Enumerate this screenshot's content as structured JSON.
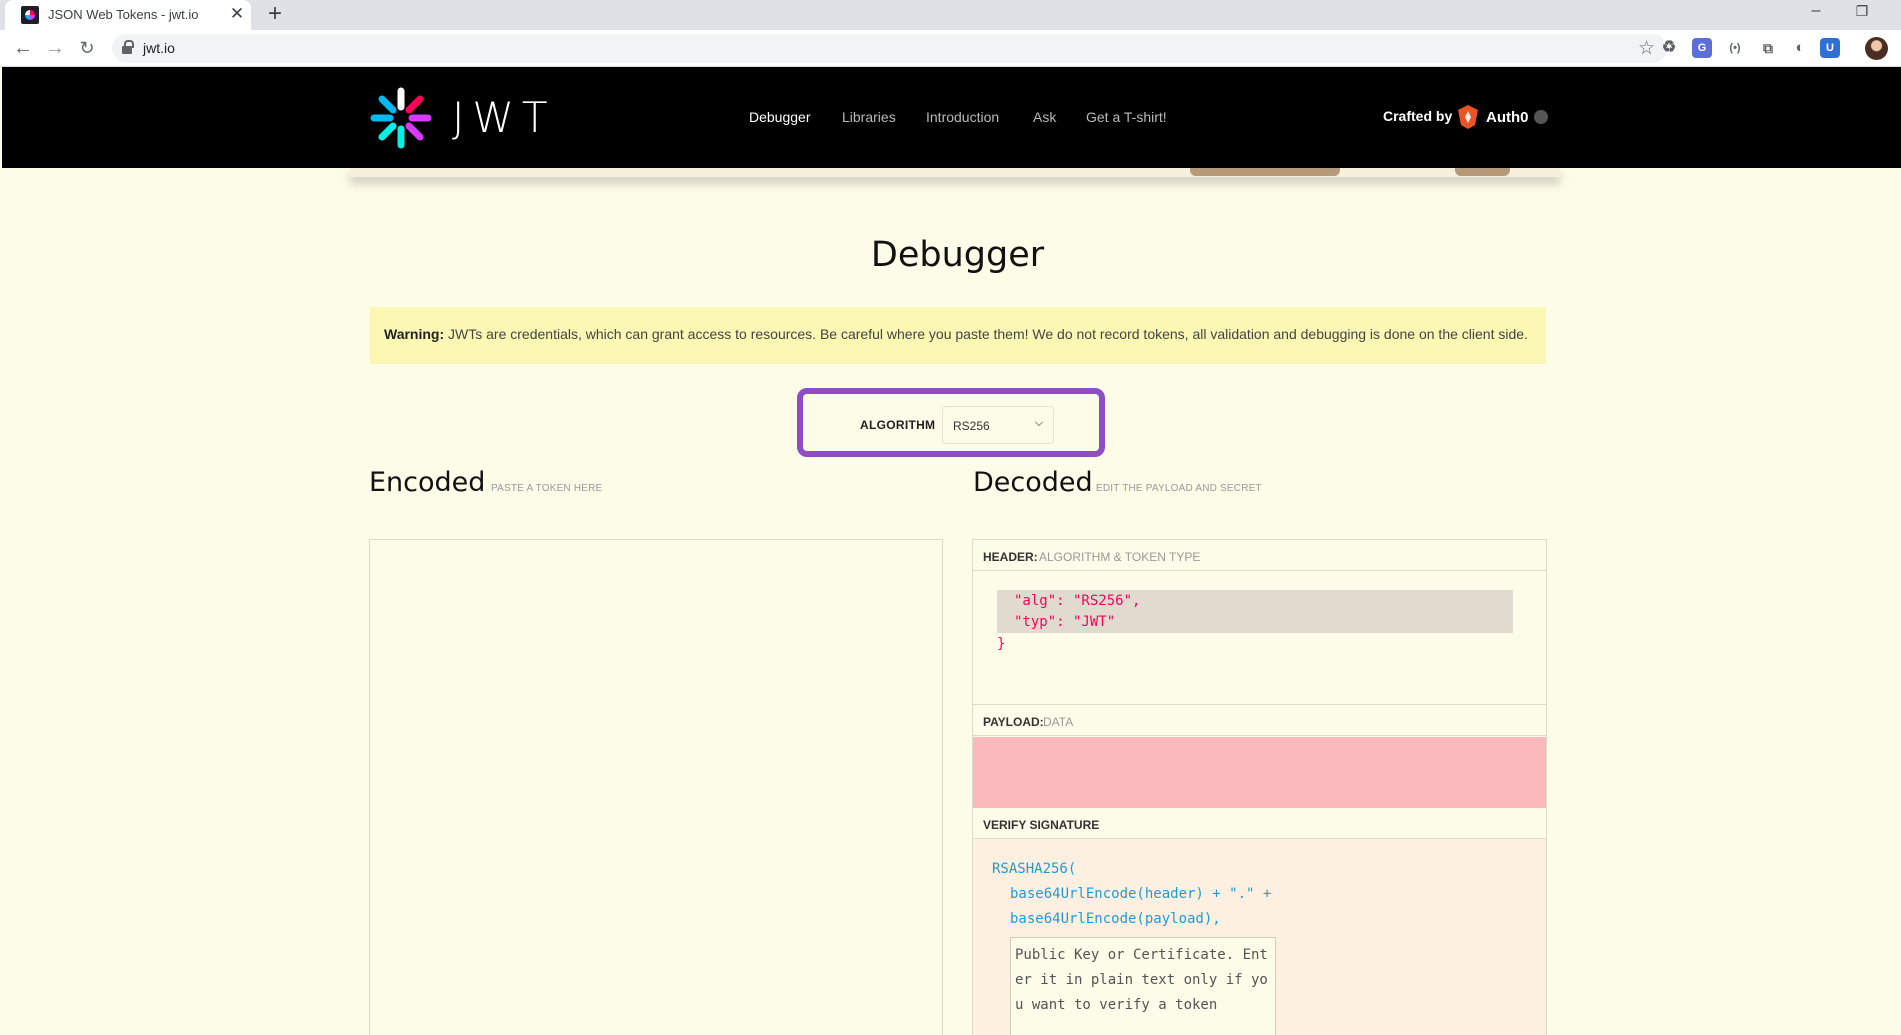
{
  "browser": {
    "tab_title": "JSON Web Tokens - jwt.io",
    "tab_close": "✕",
    "new_tab": "+",
    "url": "jwt.io",
    "window_minimize": "–",
    "window_restore": "❐"
  },
  "site": {
    "logo_word": "JWT",
    "nav": [
      "Debugger",
      "Libraries",
      "Introduction",
      "Ask",
      "Get a T-shirt!"
    ],
    "active_nav": "Debugger",
    "crafted_by": "Crafted by",
    "sponsor": "Auth0"
  },
  "main": {
    "title": "Debugger",
    "warning_bold": "Warning:",
    "warning_text": " JWTs are credentials, which can grant access to resources. Be careful where you paste them! We do not record tokens, all validation and debugging is done on the client side.",
    "algorithm_label": "ALGORITHM",
    "algorithm_value": "RS256"
  },
  "encoded": {
    "title": "Encoded",
    "hint": "PASTE A TOKEN HERE"
  },
  "decoded": {
    "title": "Decoded",
    "hint": "EDIT THE PAYLOAD AND SECRET",
    "header_label": "HEADER:",
    "header_sub": "ALGORITHM & TOKEN TYPE",
    "header_lines": [
      "\"alg\": \"RS256\",",
      "\"typ\": \"JWT\"",
      "}"
    ],
    "payload_label": "PAYLOAD:",
    "payload_sub": "DATA",
    "verify_label": "VERIFY SIGNATURE",
    "verify_lines": [
      "RSASHA256(",
      "base64UrlEncode(header) + \".\" +",
      "base64UrlEncode(payload),"
    ],
    "secret_placeholder": "Public Key or Certificate. Enter it in plain text only if you want to verify a token"
  },
  "colors": {
    "accent_highlight": "#8e4dc7",
    "token_red": "#fb015b",
    "token_blue": "#1f9bdb",
    "payload_bg": "#fbb8bd",
    "warning_bg": "#fbf8b4"
  }
}
